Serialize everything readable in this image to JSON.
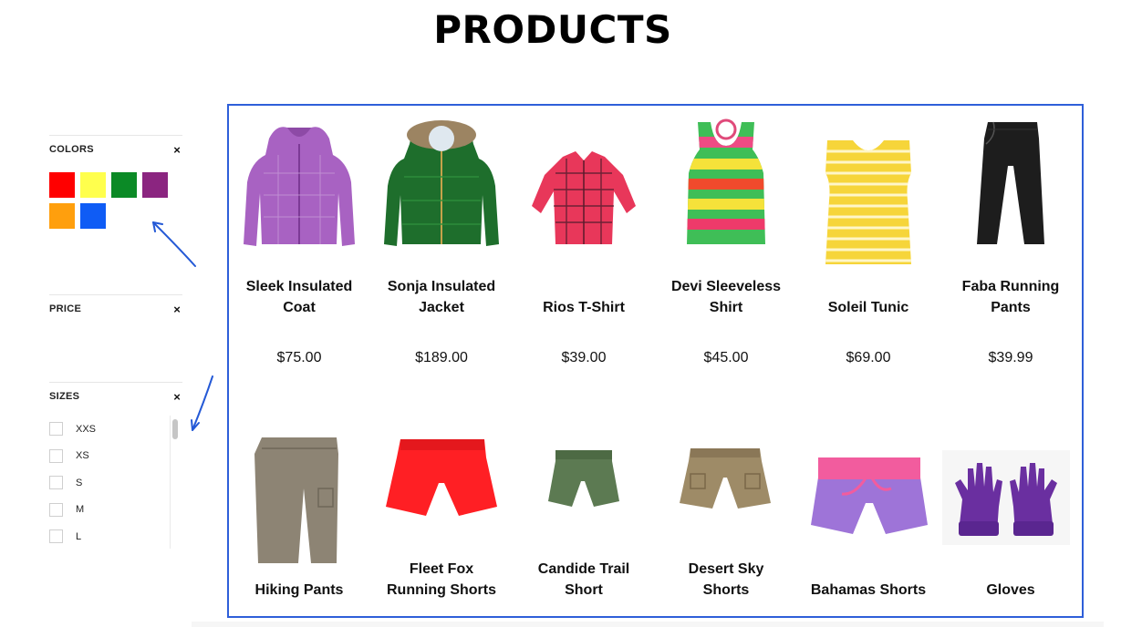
{
  "page": {
    "title": "PRODUCTS"
  },
  "filters": {
    "colors": {
      "title": "COLORS",
      "close": "×",
      "swatches": [
        {
          "name": "red",
          "color": "#ff0000"
        },
        {
          "name": "yellow",
          "color": "#ffff4d"
        },
        {
          "name": "green",
          "color": "#0b8a26"
        },
        {
          "name": "purple",
          "color": "#8b2580"
        },
        {
          "name": "orange",
          "color": "#ff9f0d"
        },
        {
          "name": "blue",
          "color": "#0f5cf5"
        }
      ]
    },
    "price": {
      "title": "PRICE",
      "close": "×"
    },
    "sizes": {
      "title": "SIZES",
      "close": "×",
      "items": [
        {
          "label": "XXS"
        },
        {
          "label": "XS"
        },
        {
          "label": "S"
        },
        {
          "label": "M"
        },
        {
          "label": "L"
        }
      ]
    }
  },
  "products": [
    {
      "name": "Sleek Insulated\nCoat",
      "price": "$75.00",
      "image": "purple-plaid-jacket"
    },
    {
      "name": "Sonja Insulated\nJacket",
      "price": "$189.00",
      "image": "green-fur-hood-jacket"
    },
    {
      "name": "Rios T-Shirt",
      "price": "$39.00",
      "image": "red-plaid-shirt"
    },
    {
      "name": "Devi Sleeveless\nShirt",
      "price": "$45.00",
      "image": "striped-tank-top"
    },
    {
      "name": "Soleil Tunic",
      "price": "$69.00",
      "image": "yellow-striped-tunic"
    },
    {
      "name": "Faba Running\nPants",
      "price": "$39.99",
      "image": "black-pants"
    },
    {
      "name": "Hiking Pants",
      "price": "",
      "image": "khaki-pants"
    },
    {
      "name": "Fleet Fox\nRunning Shorts",
      "price": "",
      "image": "red-shorts"
    },
    {
      "name": "Candide Trail\nShort",
      "price": "",
      "image": "olive-shorts"
    },
    {
      "name": "Desert Sky\nShorts",
      "price": "",
      "image": "tan-cargo-shorts"
    },
    {
      "name": "Bahamas Shorts",
      "price": "",
      "image": "purple-pink-shorts"
    },
    {
      "name": "Gloves",
      "price": "",
      "image": "purple-gloves"
    }
  ],
  "colors": {
    "frame": "#2e5fd9",
    "arrow": "#2459d6"
  }
}
